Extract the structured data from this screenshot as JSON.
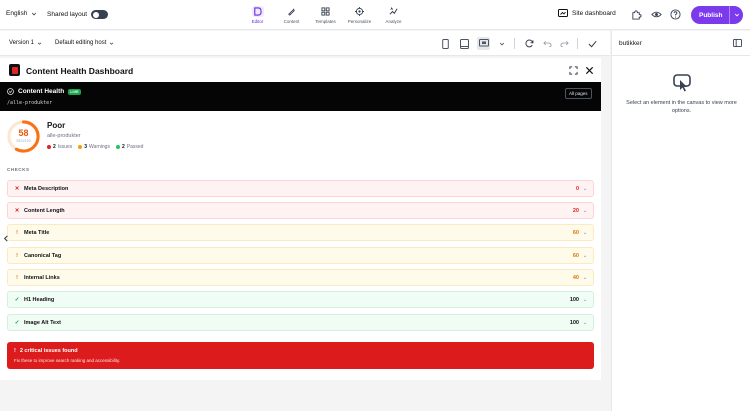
{
  "topbar": {
    "language": "English",
    "shared_layout": "Shared layout",
    "tabs": [
      {
        "label": "Editor",
        "icon": "editor-icon"
      },
      {
        "label": "Content",
        "icon": "pen-icon"
      },
      {
        "label": "Templates",
        "icon": "templates-icon"
      },
      {
        "label": "Personalize",
        "icon": "target-icon"
      },
      {
        "label": "Analyze",
        "icon": "analyze-icon"
      }
    ],
    "site_dashboard": "Site dashboard",
    "publish": "Publish"
  },
  "toolbar": {
    "version": "Version 1",
    "host": "Default editing host"
  },
  "right_panel": {
    "title": "butikker",
    "empty_message": "Select an element in the canvas to view more options."
  },
  "dialog": {
    "title": "Content Health Dashboard",
    "hero_title": "Content Health",
    "live_badge": "LIVE",
    "path": "/alle-produkter",
    "all_pages": "All pages",
    "score": "58",
    "score_label": "SEO/100",
    "score_fraction": 0.58,
    "grade": "Poor",
    "page_name": "alle-produkter",
    "counts": [
      {
        "num": "2",
        "label": "Issues",
        "color": "#dc2626"
      },
      {
        "num": "3",
        "label": "Warnings",
        "color": "#f59e0b"
      },
      {
        "num": "2",
        "label": "Passed",
        "color": "#22c55e"
      }
    ],
    "checks_label": "CHECKS",
    "checks": [
      {
        "symbol": "✕",
        "name": "Meta Description",
        "value": "0",
        "status": "bad"
      },
      {
        "symbol": "✕",
        "name": "Content Length",
        "value": "20",
        "status": "bad"
      },
      {
        "symbol": "!",
        "name": "Meta Title",
        "value": "60",
        "status": "warn"
      },
      {
        "symbol": "!",
        "name": "Canonical Tag",
        "value": "60",
        "status": "warn"
      },
      {
        "symbol": "!",
        "name": "Internal Links",
        "value": "40",
        "status": "warn"
      },
      {
        "symbol": "✓",
        "name": "H1 Heading",
        "value": "100",
        "status": "good"
      },
      {
        "symbol": "✓",
        "name": "Image Alt Text",
        "value": "100",
        "status": "good"
      }
    ],
    "alert_title": "2 critical issues found",
    "alert_sub": "Fix these to improve search ranking and accessibility."
  }
}
